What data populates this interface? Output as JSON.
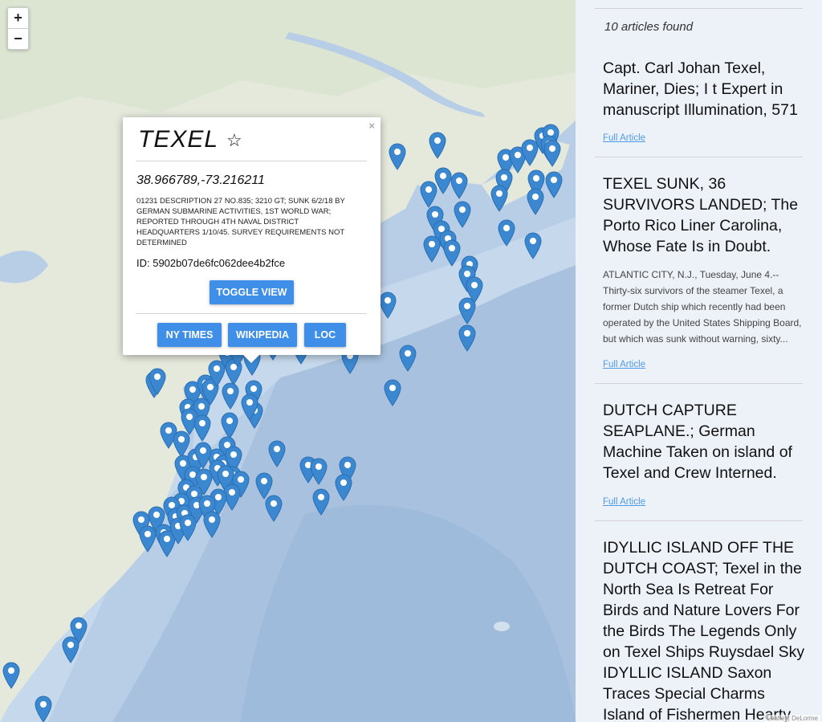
{
  "map": {
    "zoom_in_label": "+",
    "zoom_out_label": "−",
    "attribution": "Leaflet | DeLorme"
  },
  "colors": {
    "marker": "#3b87d0",
    "button": "#3f8ee8",
    "link": "#4f9ae8",
    "land": "#e4e9dc",
    "ocean": "#b8cee6"
  },
  "popup": {
    "title": "TEXEL",
    "star_icon": "☆",
    "close_icon": "×",
    "coordinates": "38.966789,-73.216211",
    "description": "01231 DESCRIPTION 27 NO.835; 3210 GT; SUNK 6/2/18 BY GERMAN SUBMARINE ACTIVITIES, 1ST WORLD WAR; REPORTED THROUGH 4TH NAVAL DISTRICT HEADQUARTERS 1/10/45. SURVEY REQUIREMENTS NOT DETERMINED",
    "id_text": "ID: 5902b07de6fc062dee4b2fce",
    "toggle_label": "TOGGLE VIEW",
    "buttons": [
      "NY TIMES",
      "WIKIPEDIA",
      "LOC"
    ]
  },
  "results": {
    "count_text": "10 articles found",
    "link_label": "Full Article",
    "articles": [
      {
        "title": "Capt. Carl Johan Texel, Mariner, Dies; I t Expert in manuscript Illumination, 571",
        "snippet": ""
      },
      {
        "title": "TEXEL SUNK, 36 SURVIVORS LANDED; The Porto Rico Liner Carolina, Whose Fate Is in Doubt.",
        "snippet": "ATLANTIC CITY, N.J., Tuesday, June 4.--Thirty-six survivors of the steamer Texel, a former Dutch ship which recently had been operated by the United States Shipping Board, but which was sunk without warning, sixty..."
      },
      {
        "title": "DUTCH CAPTURE SEAPLANE.; German Machine Taken on island of Texel and Crew Interned.",
        "snippet": ""
      },
      {
        "title": "IDYLLIC ISLAND OFF THE DUTCH COAST; Texel in the North Sea Is Retreat For Birds and Nature Lovers For the Birds The Legends Only on Texel Ships Ruysdael Sky IDYLLIC ISLAND Saxon Traces Special Charms Island of Fishermen Hearty",
        "snippet": ""
      }
    ]
  }
}
